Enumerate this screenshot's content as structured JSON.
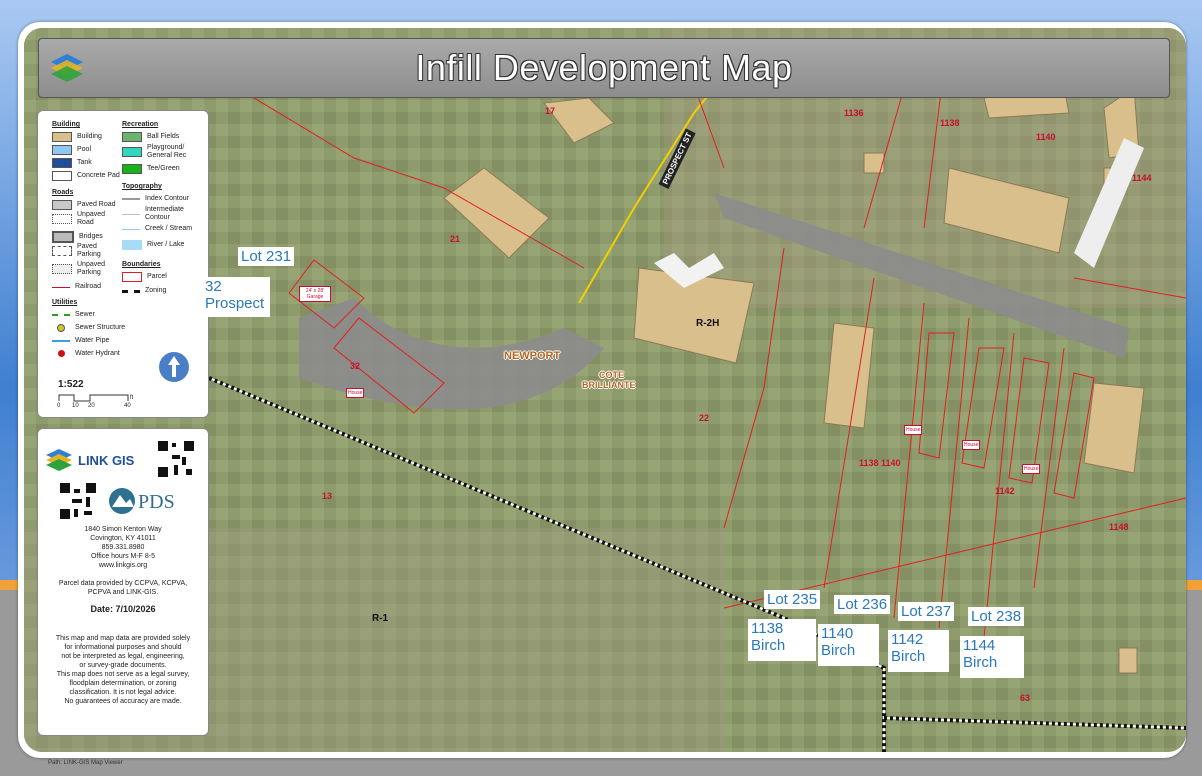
{
  "title": "Infill Development Map",
  "legend": {
    "building_head": "Building",
    "building": [
      "Building",
      "Pool",
      "Tank",
      "Concrete Pad"
    ],
    "recreation_head": "Recreation",
    "recreation": [
      "Ball Fields",
      "Playground/ General Rec",
      "Tee/Green"
    ],
    "roads_head": "Roads",
    "roads": [
      "Paved Road",
      "Unpaved Road",
      "Bridges",
      "Paved Parking",
      "Unpaved Parking",
      "Railroad"
    ],
    "topography_head": "Topography",
    "topography": [
      "Index Contour",
      "Intermediate Contour",
      "Creek / Stream",
      "River / Lake"
    ],
    "boundaries_head": "Boundaries",
    "boundaries": [
      "Parcel",
      "Zoning"
    ],
    "utilities_head": "Utilities",
    "utilities": [
      "Sewer",
      "Sewer Structure",
      "Water Pipe",
      "Water Hydrant"
    ],
    "scale": "1:522",
    "scale_ticks": [
      "0",
      "10",
      "20",
      "40"
    ],
    "scale_unit": "ft"
  },
  "info": {
    "brand": "LINK GIS",
    "pds": "PDS",
    "address1": "1840 Simon Kenton Way",
    "address2": "Covington, KY 41011",
    "phone": "859.331.8980",
    "hours": "Office hours M-F 8-5",
    "web": "www.linkgis.org",
    "source1": "Parcel data provided by CCPVA, KCPVA,",
    "source2": "PCPVA and LINK-GIS.",
    "date": "Date: 7/10/2026",
    "disc1": "This map and map data are provided solely",
    "disc2": "for informational purposes and should",
    "disc3": "not be interpreted as legal, engineering,",
    "disc4": "or survey-grade documents.",
    "disc5": "This map does not serve as a legal survey,",
    "disc6": "floodplain determination, or zoning",
    "disc7": "classification. It is not legal advice.",
    "disc8": "No guarantees of accuracy are made."
  },
  "labels": {
    "lot231": "Lot 231",
    "prospect32_a": "32",
    "prospect32_b": "Prospect",
    "lot235": "Lot 235",
    "lot236": "Lot 236",
    "lot237": "Lot 237",
    "lot238": "Lot 238",
    "b1138_a": "1138",
    "b1138_b": "Birch",
    "b1140_a": "1140",
    "b1140_b": "Birch",
    "b1142_a": "1142",
    "b1142_b": "Birch",
    "b1144_a": "1144",
    "b1144_b": "Birch"
  },
  "map": {
    "street_prospect": "PROSPECT ST",
    "newport": "NEWPORT",
    "cote1": "COTE",
    "cote2": "BRILLIANTE",
    "zone_r2h": "R-2H",
    "zone_r1": "R-1",
    "n17": "17",
    "n21": "21",
    "n32": "32",
    "n13": "13",
    "n22": "22",
    "n1136": "1136",
    "n1138top": "1138",
    "n1140top": "1140",
    "n1144": "1144",
    "n1138_1140": "1138 1140",
    "n1142": "1142",
    "n1148": "1148",
    "n63": "63",
    "house": "House",
    "garage": "24' x 28' Garage"
  },
  "footer": {
    "path": "Path: LINK-GIS Map Viewer"
  },
  "colors": {
    "parcel": "#e02020",
    "road": "#8c8c8c",
    "building": "#d9bf8c",
    "label": "#2c79b8"
  }
}
